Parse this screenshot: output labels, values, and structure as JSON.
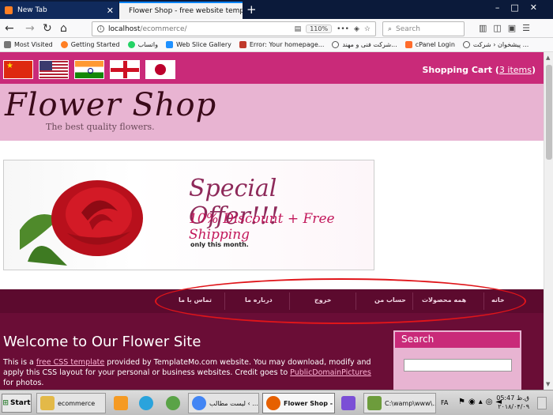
{
  "browser": {
    "tabs": [
      {
        "label": "New Tab"
      },
      {
        "label": "Flower Shop - free website template, H"
      }
    ],
    "url_host": "localhost",
    "url_path": "/ecommerce/",
    "zoom": "110%",
    "search_placeholder": "Search",
    "bookmarks": [
      {
        "label": "Most Visited",
        "color": "#777777"
      },
      {
        "label": "Getting Started",
        "color": "#ff7f24"
      },
      {
        "label": "واتساب",
        "color": "#25d366"
      },
      {
        "label": "Web Slice Gallery",
        "color": "#1e90ff"
      },
      {
        "label": "Error: Your homepage...",
        "color": "#c0392b"
      },
      {
        "label": "شرکت فنی و مهند...",
        "color": "#555555"
      },
      {
        "label": "cPanel Login",
        "color": "#ff6c2c"
      },
      {
        "label": "پیشخوان ‹ شرکت ...",
        "color": "#555555"
      }
    ]
  },
  "site": {
    "cart_label": "Shopping Cart",
    "cart_items": "3 items",
    "logo_text": "Flower Shop",
    "tagline": "The best quality flowers.",
    "banner": {
      "title": "Special Offer!!!",
      "subtitle": "10% Discount + Free Shipping",
      "note": "only this month."
    },
    "menu": [
      "خانه",
      "همه محصولات",
      "حساب من",
      "خروج",
      "درباره ما",
      "تماس با ما"
    ],
    "welcome_title": "Welcome to Our Flower Site",
    "intro": {
      "p1": "This is a ",
      "link1": "free CSS template",
      "p2": " provided by TemplateMo.com website. You may download, modify and apply this CSS layout for your personal or business websites. Credit goes to ",
      "link2": "PublicDomainPictures",
      "p3": " for photos."
    },
    "search_title": "Search"
  },
  "taskbar": {
    "start": "Start",
    "items": [
      {
        "label": "ecommerce",
        "color": "#e3b948"
      },
      {
        "label": "",
        "color": "#f59a23"
      },
      {
        "label": "",
        "color": "#2aa3dc"
      },
      {
        "label": "",
        "color": "#5aa347"
      },
      {
        "label": "لیست مطالب ‹ ...",
        "color": "#4285f4"
      },
      {
        "label": "Flower Shop - ...",
        "color": "#e66000"
      },
      {
        "label": "",
        "color": "#7b4fd6"
      },
      {
        "label": "C:\\wamp\\www\\...",
        "color": "#6d9c3c"
      }
    ],
    "lang": "FA",
    "time": "05:47 ق.ظ",
    "date": "۲۰۱۸/۰۴/۰۹"
  }
}
